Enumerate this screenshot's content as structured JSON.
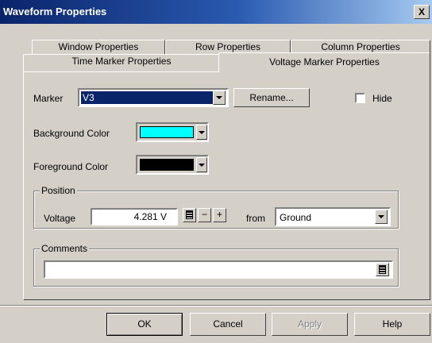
{
  "window": {
    "title": "Waveform Properties",
    "close": "X"
  },
  "tabs": {
    "back": [
      "Window Properties",
      "Row Properties",
      "Column Properties"
    ],
    "front": [
      "Time Marker Properties",
      "Voltage Marker Properties"
    ],
    "active": "Voltage Marker Properties"
  },
  "marker": {
    "label": "Marker",
    "value": "V3",
    "rename": "Rename...",
    "hide_label": "Hide",
    "hide_checked": false
  },
  "background": {
    "label": "Background Color",
    "color": "#00ffff"
  },
  "foreground": {
    "label": "Foreground Color",
    "color": "#000000"
  },
  "position": {
    "legend": "Position",
    "voltage_label": "Voltage",
    "voltage_value": "4.281 V",
    "minus": "−",
    "plus": "+",
    "from_label": "from",
    "from_value": "Ground"
  },
  "comments": {
    "legend": "Comments",
    "value": ""
  },
  "buttons": {
    "ok": "OK",
    "cancel": "Cancel",
    "apply": "Apply",
    "help": "Help"
  }
}
